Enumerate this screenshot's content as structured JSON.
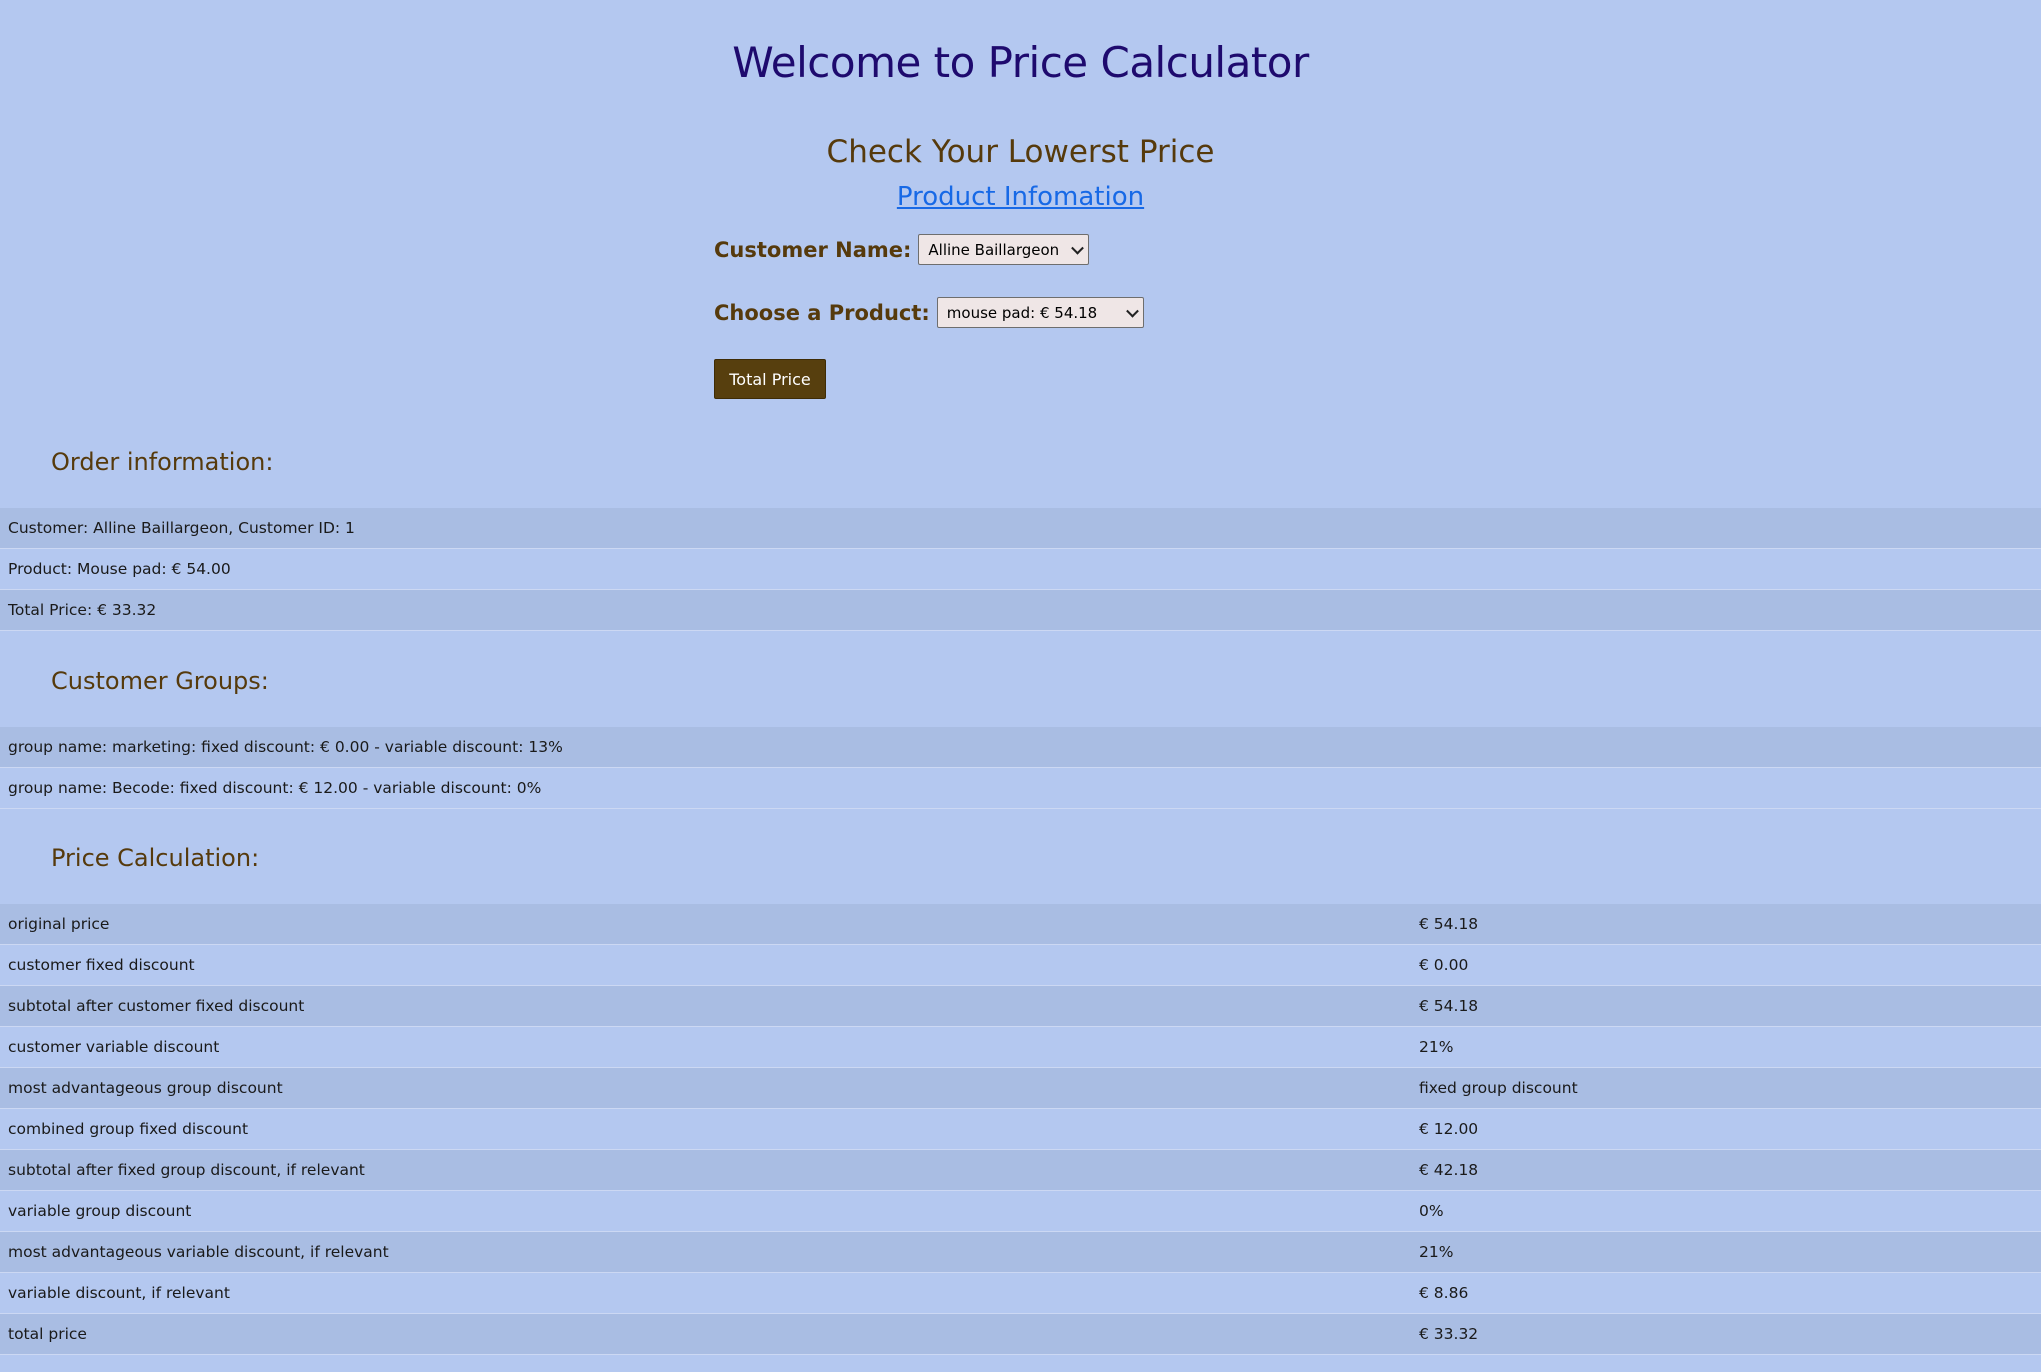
{
  "header": {
    "title": "Welcome to Price Calculator",
    "subtitle": "Check Your Lowerst Price",
    "product_link": "Product Infomation"
  },
  "form": {
    "customer_label": "Customer Name:",
    "customer_selected": "Alline Baillargeon",
    "product_label": "Choose a Product:",
    "product_selected": "mouse pad: € 54.18",
    "submit_label": "Total Price"
  },
  "order": {
    "heading": "Order information:",
    "rows": [
      "Customer: Alline Baillargeon, Customer ID: 1",
      "Product: Mouse pad: € 54.00",
      "Total Price: € 33.32"
    ]
  },
  "groups": {
    "heading": "Customer Groups:",
    "rows": [
      "group name: marketing: fixed discount: € 0.00 - variable discount: 13%",
      "group name: Becode: fixed discount: € 12.00 - variable discount: 0%"
    ]
  },
  "calculation": {
    "heading": "Price Calculation:",
    "rows": [
      {
        "label": "original price",
        "value": "€ 54.18"
      },
      {
        "label": "customer fixed discount",
        "value": "€ 0.00"
      },
      {
        "label": "subtotal after customer fixed discount",
        "value": "€ 54.18"
      },
      {
        "label": "customer variable discount",
        "value": "21%"
      },
      {
        "label": "most advantageous group discount",
        "value": "fixed group discount"
      },
      {
        "label": "combined group fixed discount",
        "value": "€ 12.00"
      },
      {
        "label": "subtotal after fixed group discount, if relevant",
        "value": "€ 42.18"
      },
      {
        "label": "variable group discount",
        "value": "0%"
      },
      {
        "label": "most advantageous variable discount, if relevant",
        "value": "21%"
      },
      {
        "label": "variable discount, if relevant",
        "value": "€ 8.86"
      },
      {
        "label": "total price",
        "value": "€ 33.32"
      }
    ]
  },
  "colors": {
    "background": "#b4c8f0",
    "row_alt": "#a9bde3",
    "title": "#1e0a6e",
    "accent_brown": "#563a0c",
    "link": "#1769e6"
  }
}
